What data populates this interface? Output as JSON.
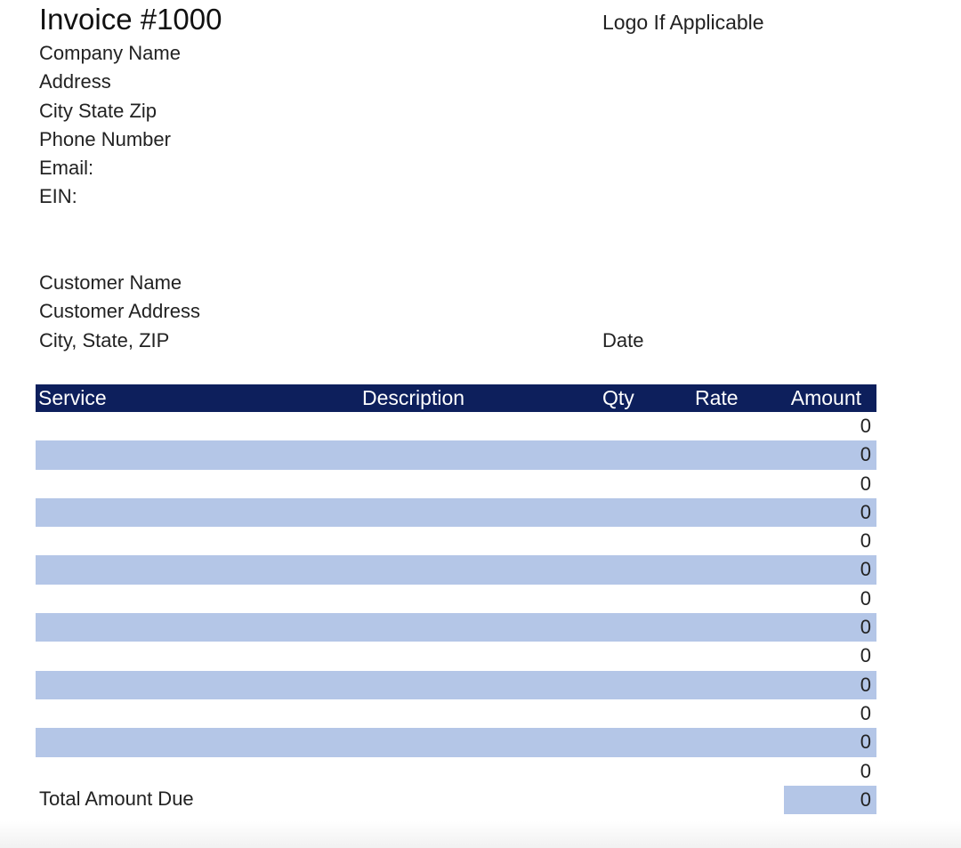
{
  "invoice": {
    "title": "Invoice #1000",
    "logo_placeholder": "Logo If Applicable"
  },
  "company": {
    "name": "Company Name",
    "address": "Address",
    "city_state_zip": "City State Zip",
    "phone": "Phone Number",
    "email": "Email:",
    "ein": "EIN:"
  },
  "customer": {
    "name": "Customer Name",
    "address": "Customer Address",
    "city_state_zip": "City, State, ZIP"
  },
  "date_label": "Date",
  "table": {
    "columns": [
      "Service",
      "Description",
      "Qty",
      "Rate",
      "Amount"
    ],
    "row_amounts": [
      "0",
      "0",
      "0",
      "0",
      "0",
      "0",
      "0",
      "0",
      "0",
      "0",
      "0",
      "0",
      "0"
    ]
  },
  "total": {
    "label": "Total Amount Due",
    "amount": "0"
  },
  "colors": {
    "header_bg": "#0d1f5c",
    "alt_row_bg": "#b4c6e7"
  }
}
